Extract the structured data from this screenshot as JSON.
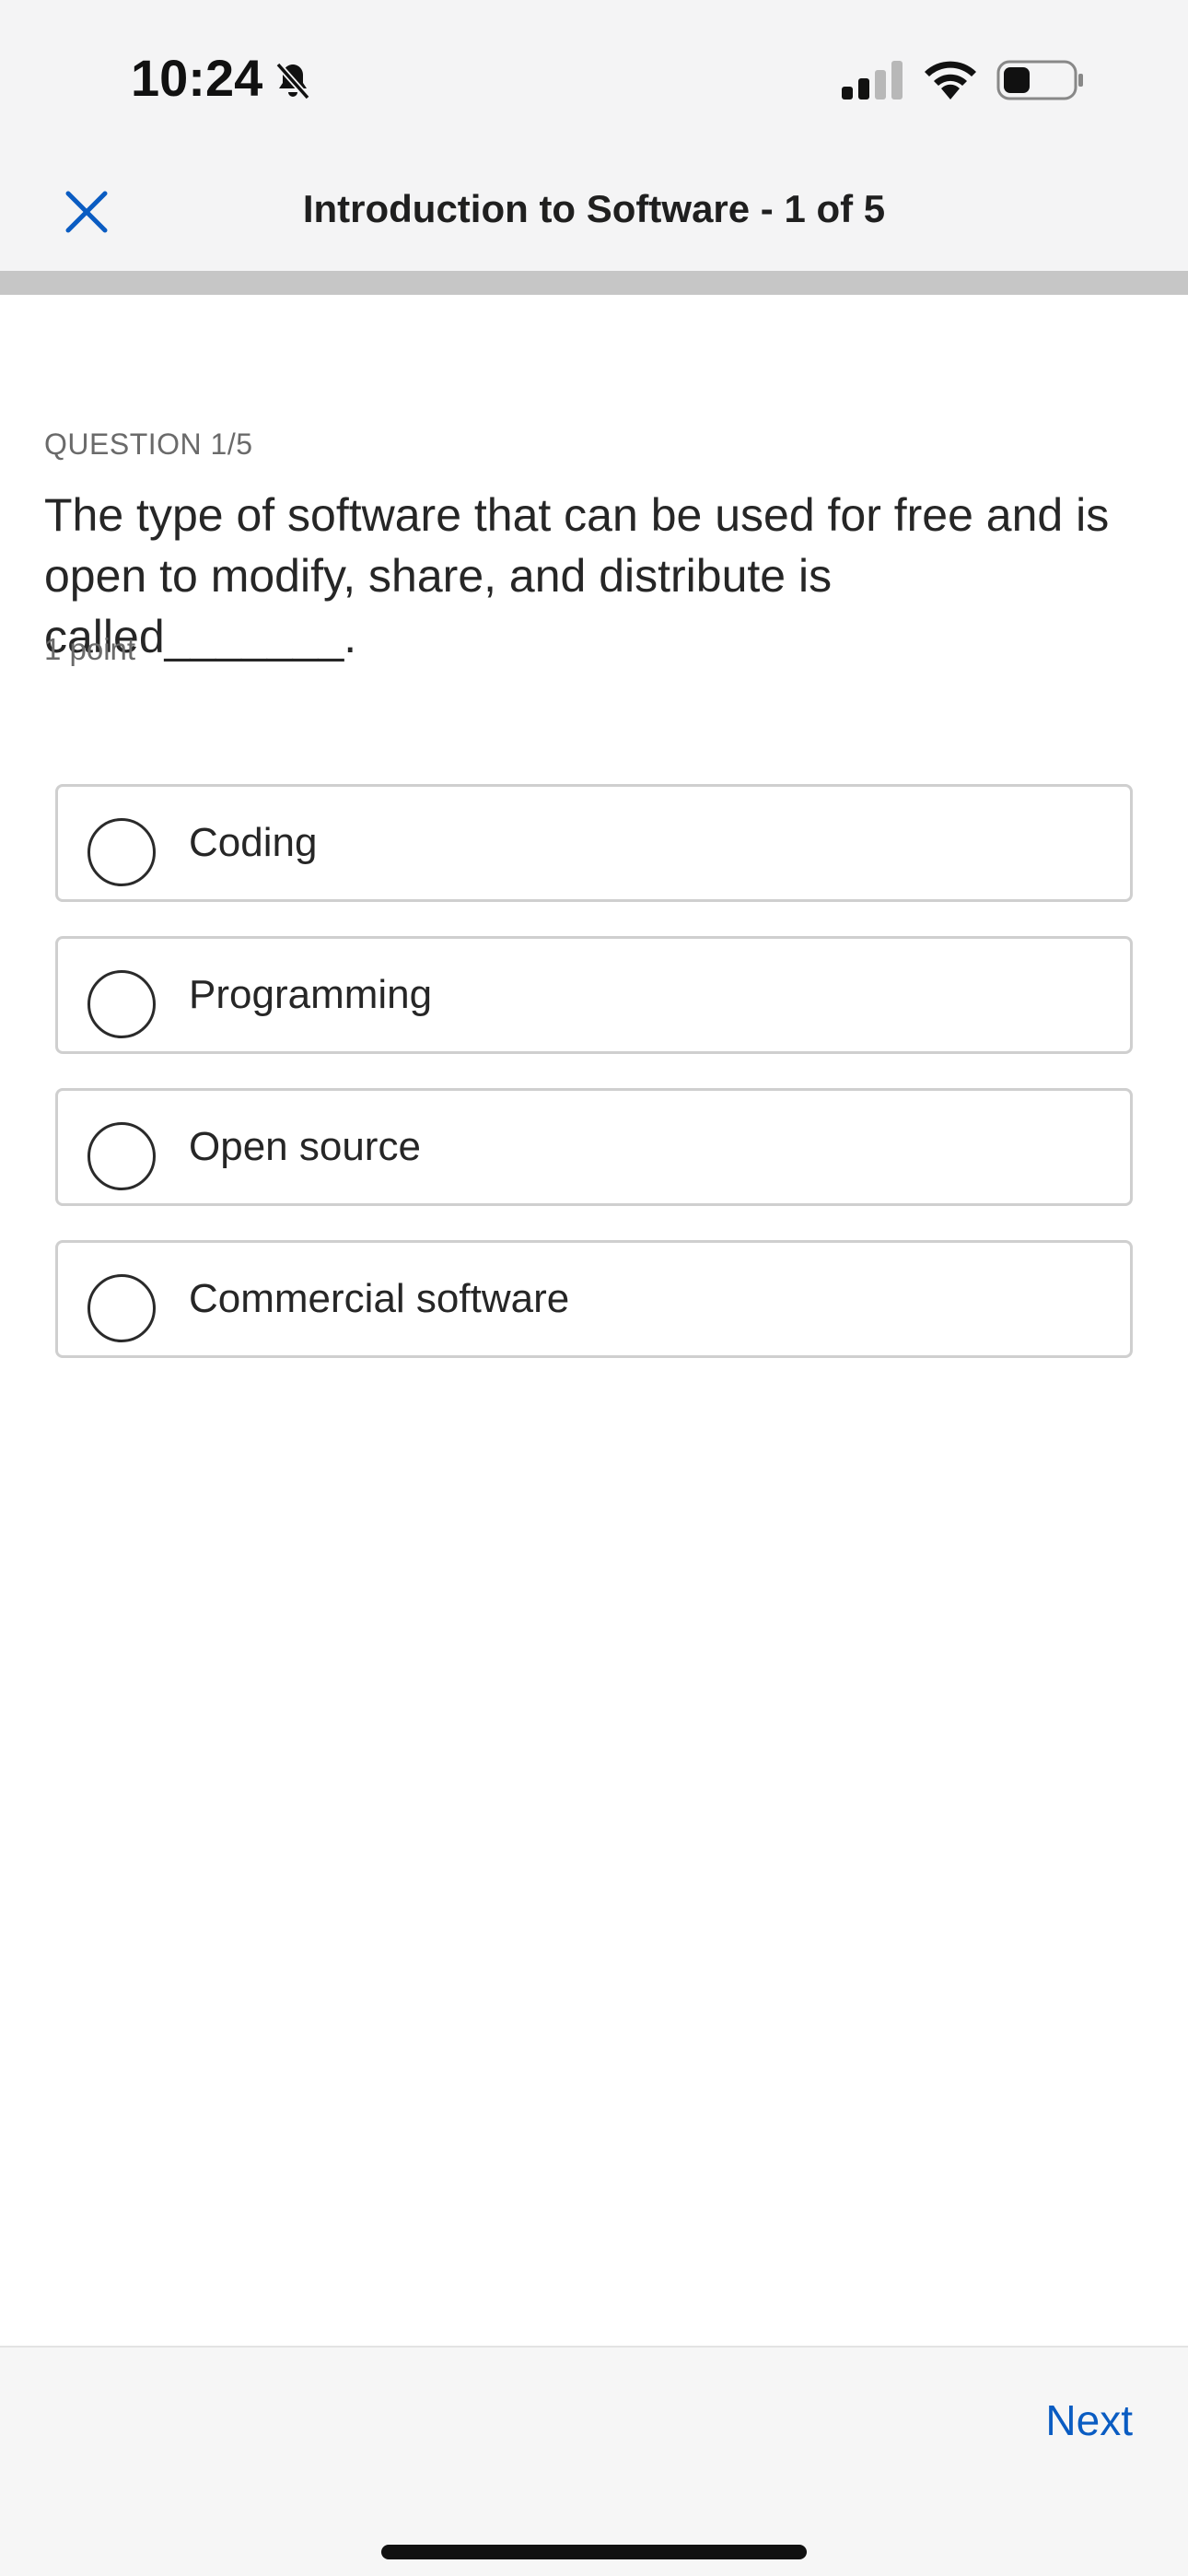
{
  "status_bar": {
    "time": "10:24",
    "icons": [
      "bell-slash-icon",
      "cellular-signal-icon",
      "wifi-icon",
      "battery-icon"
    ]
  },
  "header": {
    "close_icon": "close-icon",
    "title": "Introduction to Software - 1 of 5",
    "progress_fraction": 0.2
  },
  "question": {
    "label": "QUESTION 1/5",
    "text": "The type of software that can be used for free and is open to modify, share, and distribute is called_______.",
    "points": "1 point",
    "options": [
      {
        "label": "Coding",
        "selected": false
      },
      {
        "label": "Programming",
        "selected": false
      },
      {
        "label": "Open source",
        "selected": false
      },
      {
        "label": "Commercial software",
        "selected": false
      }
    ]
  },
  "footer": {
    "next_label": "Next"
  },
  "colors": {
    "accent": "#0a5cc2",
    "header_bg": "#f4f4f5",
    "progress_track": "#c6c6c6",
    "option_border": "#cfcfcf"
  }
}
